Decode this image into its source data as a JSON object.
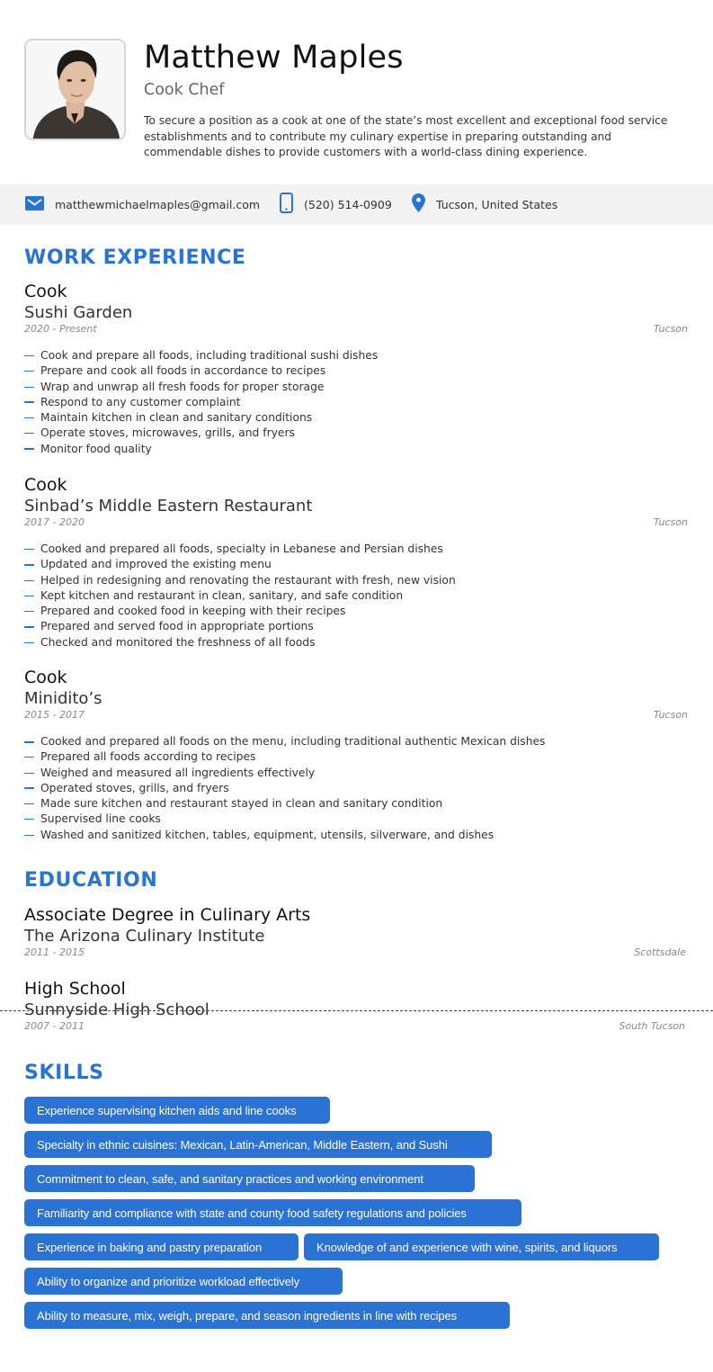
{
  "profile": {
    "name": "Matthew Maples",
    "title": "Cook Chef",
    "summary": "To secure a position as a cook at one of the state’s most excellent and exceptional food service establishments and to contribute my culinary expertise in preparing outstanding and commendable dishes to provide customers with a world-class dining experience.",
    "photo_icon": "person-portrait"
  },
  "contact": {
    "email": "matthewmichaelmaples@gmail.com",
    "phone": "(520) 514-0909",
    "location": "Tucson, United States",
    "icons": {
      "email": "envelope-icon",
      "phone": "mobile-phone-icon",
      "location": "map-pin-icon"
    }
  },
  "colors": {
    "accent": "#2873d6",
    "skill_bg": "#2a72d4",
    "contact_bar_bg": "#f2f2f2"
  },
  "sections": {
    "work_title": "WORK EXPERIENCE",
    "education_title": "EDUCATION",
    "skills_title": "SKILLS"
  },
  "work": [
    {
      "role": "Cook",
      "company": "Sushi Garden",
      "dates": "2020 - Present",
      "location": "Tucson",
      "bullets": [
        "Cook and prepare all foods, including traditional sushi dishes",
        "Prepare and cook all foods in accordance to recipes",
        "Wrap and unwrap all fresh foods for proper storage",
        "Respond to any customer complaint",
        "Maintain kitchen in clean and sanitary conditions",
        "Operate stoves, microwaves, grills, and fryers",
        "Monitor food quality"
      ]
    },
    {
      "role": "Cook",
      "company": "Sinbad’s Middle Eastern Restaurant",
      "dates": "2017 - 2020",
      "location": "Tucson",
      "bullets": [
        "Cooked and prepared all foods, specialty in Lebanese and Persian dishes",
        "Updated and improved the existing menu",
        "Helped in redesigning and renovating the restaurant with fresh, new vision",
        "Kept kitchen and restaurant in clean, sanitary, and safe condition",
        "Prepared and cooked food in keeping with their recipes",
        "Prepared and served food in appropriate portions",
        "Checked and monitored the freshness of all foods"
      ]
    },
    {
      "role": "Cook",
      "company": "Minidito’s",
      "dates": "2015 - 2017",
      "location": "Tucson",
      "bullets": [
        "Cooked and prepared all foods on the menu, including traditional authentic Mexican dishes",
        "Prepared all foods according to recipes",
        "Weighed and measured all ingredients effectively",
        "Operated stoves, grills, and fryers",
        "Made sure kitchen and restaurant stayed in clean and sanitary condition",
        "Supervised line cooks",
        "Washed and sanitized kitchen, tables, equipment, utensils, silverware, and dishes"
      ]
    }
  ],
  "education": [
    {
      "degree": "Associate Degree in Culinary Arts",
      "school": "The Arizona Culinary Institute",
      "dates": "2011 - 2015",
      "location": "Scottsdale"
    },
    {
      "degree": "High School",
      "school": "Sunnyside High School",
      "dates": "2007 - 2011",
      "location": "South Tucson"
    }
  ],
  "skills": [
    "Experience supervising kitchen aids and line cooks",
    "Specialty in ethnic cuisines: Mexican, Latin-American, Middle Eastern, and Sushi",
    "Commitment to clean, safe, and sanitary practices and working environment",
    "Familiarity and compliance with state and county food safety regulations and policies",
    "Experience in baking and pastry preparation",
    "Knowledge of and experience with wine, spirits, and liquors",
    "Ability to organize and prioritize workload effectively",
    "Ability to measure, mix, weigh, prepare, and season ingredients in line with recipes"
  ]
}
